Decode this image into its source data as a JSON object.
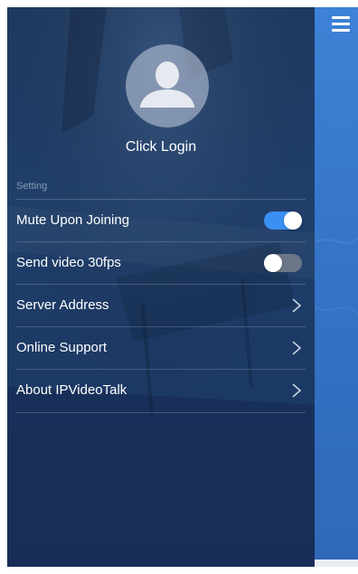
{
  "drawer": {
    "login_label": "Click Login",
    "section_label": "Setting",
    "items": [
      {
        "label": "Mute Upon Joining",
        "control": "toggle",
        "on": true,
        "icon": "toggle-switch"
      },
      {
        "label": "Send video 30fps",
        "control": "toggle",
        "on": false,
        "icon": "toggle-switch"
      },
      {
        "label": "Server Address",
        "control": "chevron",
        "icon": "chevron-right-icon"
      },
      {
        "label": "Online Support",
        "control": "chevron",
        "icon": "chevron-right-icon"
      },
      {
        "label": "About IPVideoTalk",
        "control": "chevron",
        "icon": "chevron-right-icon"
      }
    ],
    "avatar_icon": "user-avatar-icon"
  },
  "header": {
    "menu_icon": "hamburger-menu-icon"
  },
  "colors": {
    "drawer_bg": "#1f3a62",
    "toggle_on": "#3b8ff0",
    "toggle_off": "#6b7686",
    "main_accent": "#3473c6",
    "text": "#ffffff"
  }
}
